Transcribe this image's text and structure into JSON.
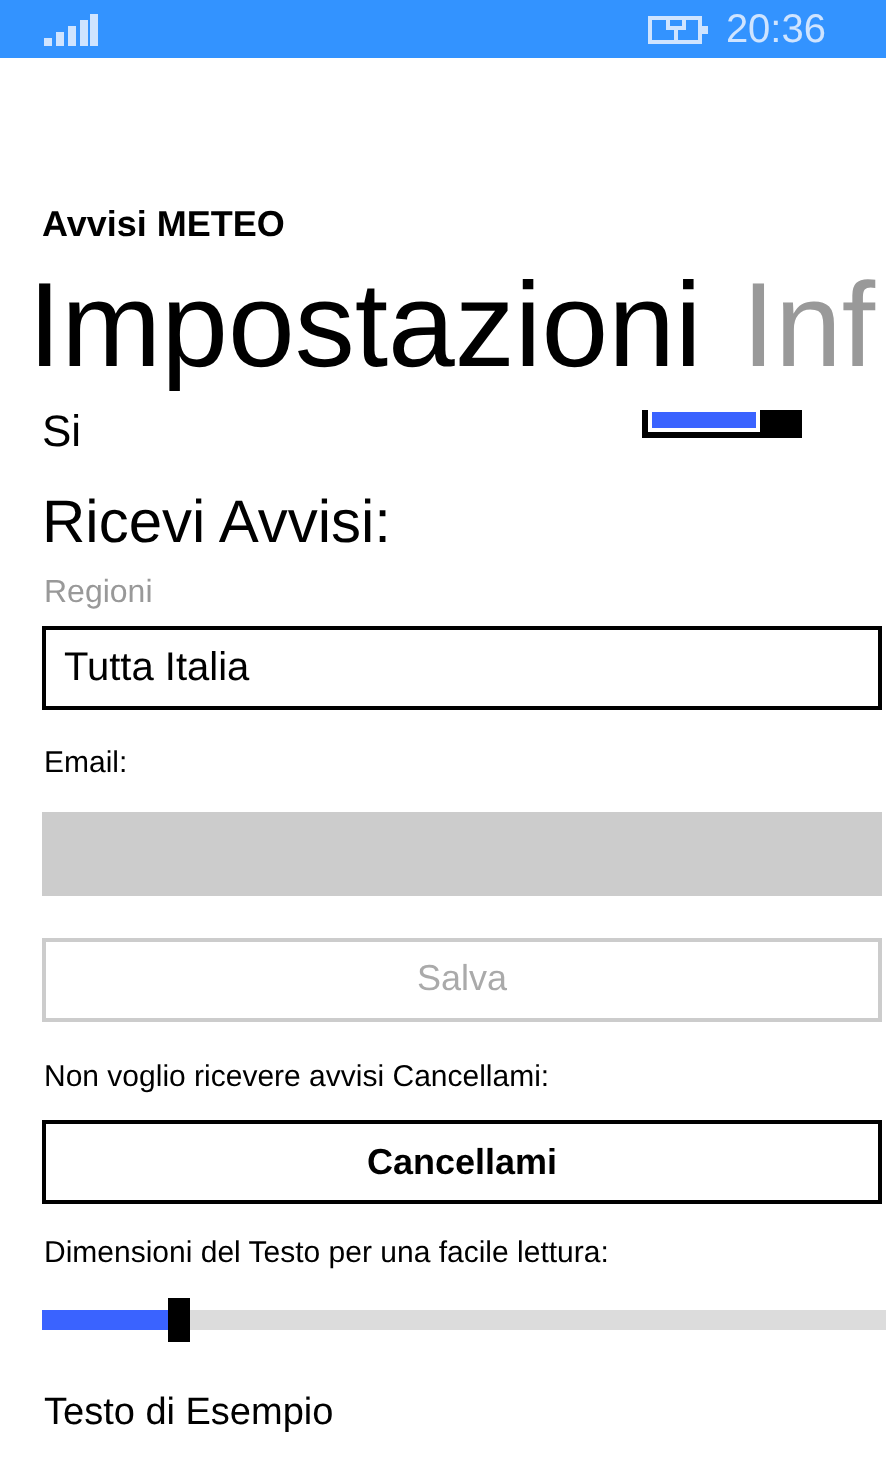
{
  "status_bar": {
    "time": "20:36"
  },
  "app_title": "Avvisi METEO",
  "pivot": [
    {
      "label": "Impostazioni",
      "selected": true
    },
    {
      "label": "Inf",
      "selected": false
    }
  ],
  "cut_toggle": {
    "label": "Si",
    "on": true
  },
  "section_title": "Ricevi Avvisi:",
  "region": {
    "label": "Regioni",
    "value": "Tutta Italia"
  },
  "email": {
    "label": "Email:",
    "disabled": true
  },
  "save_button": {
    "label": "Salva",
    "disabled": true
  },
  "unsubscribe": {
    "label": "Non voglio ricevere avvisi Cancellami:",
    "button": "Cancellami"
  },
  "text_size": {
    "label": "Dimensioni del Testo per una facile lettura:",
    "level": 0.16
  },
  "sample_text": "Testo di Esempio"
}
